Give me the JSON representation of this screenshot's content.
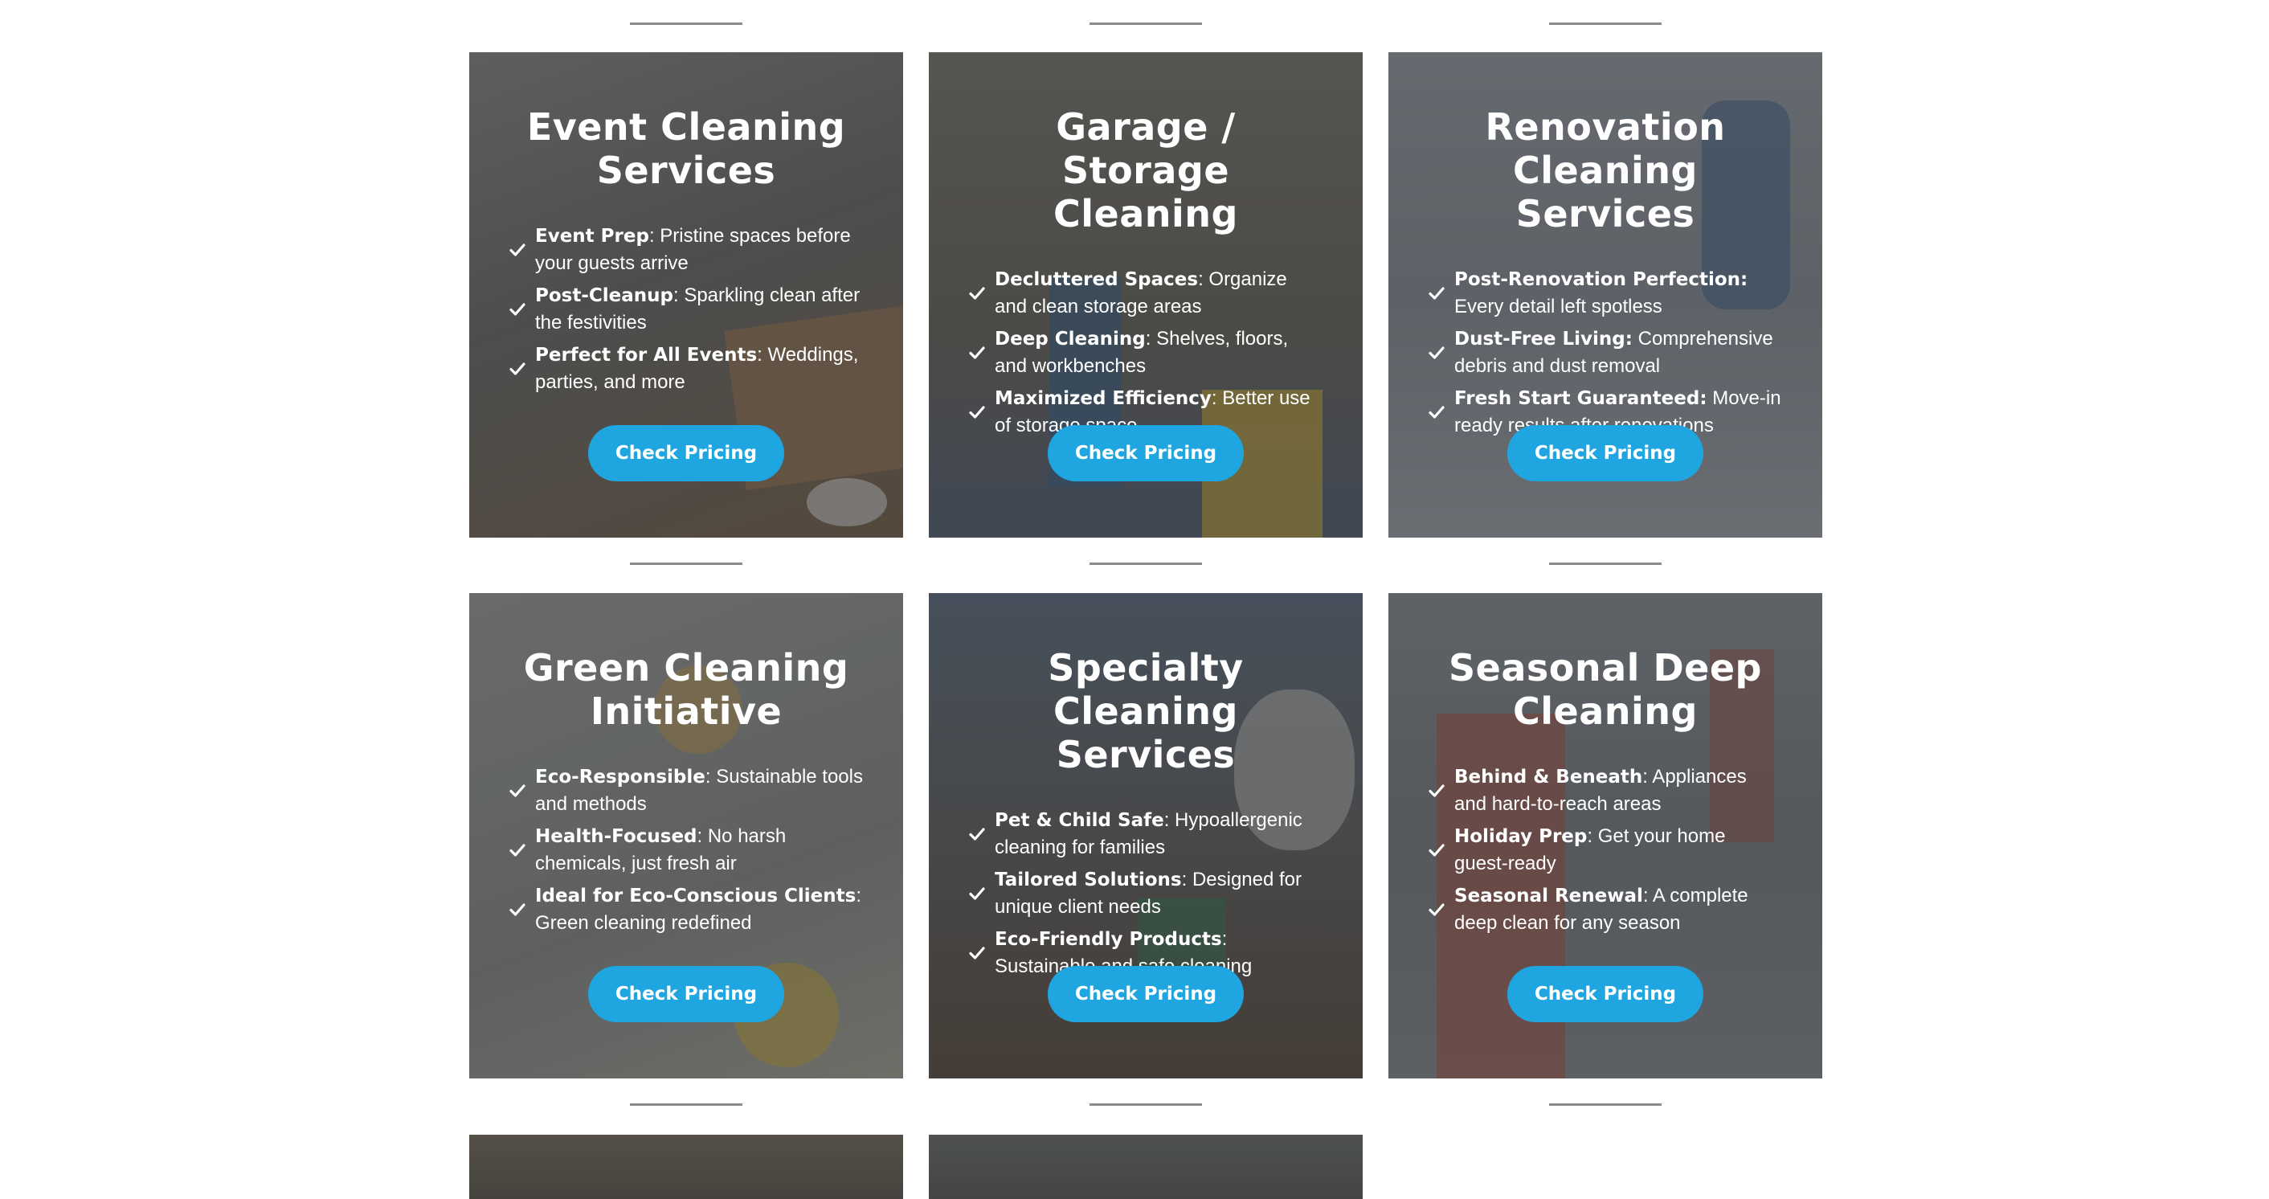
{
  "cards": [
    {
      "title": "Event Cleaning Services",
      "items": [
        {
          "bold": "Event Prep",
          "text": ": Pristine spaces before your guests arrive"
        },
        {
          "bold": "Post-Cleanup",
          "text": ": Sparkling clean after the festivities"
        },
        {
          "bold": "Perfect for All Events",
          "text": ": Weddings, parties, and more"
        }
      ],
      "button": "Check Pricing",
      "bg_color": "#6f6a62"
    },
    {
      "title": "Garage / Storage Cleaning",
      "items": [
        {
          "bold": "Decluttered Spaces",
          "text": ": Organize and clean storage areas"
        },
        {
          "bold": "Deep Cleaning",
          "text": ": Shelves, floors, and workbenches"
        },
        {
          "bold": "Maximized Efficiency",
          "text": ": Better use of storage space"
        }
      ],
      "button": "Check Pricing",
      "bg_color": "#6b6356"
    },
    {
      "title": "Renovation Cleaning Services",
      "items": [
        {
          "bold": "Post-Renovation Perfection:",
          "text": " Every detail left spotless"
        },
        {
          "bold": "Dust-Free Living:",
          "text": " Comprehensive debris and dust removal"
        },
        {
          "bold": "Fresh Start Guaranteed:",
          "text": " Move-in ready results after renovations"
        }
      ],
      "button": "Check Pricing",
      "bg_color": "#8a8d93"
    },
    {
      "title": "Green Cleaning Initiative",
      "items": [
        {
          "bold": "Eco-Responsible",
          "text": ": Sustainable tools and methods"
        },
        {
          "bold": "Health-Focused",
          "text": ": No harsh chemicals, just fresh air"
        },
        {
          "bold": "Ideal for Eco-Conscious Clients",
          "text": ": Green cleaning redefined"
        }
      ],
      "button": "Check Pricing",
      "bg_color": "#8c8b86"
    },
    {
      "title": "Specialty Cleaning Services",
      "items": [
        {
          "bold": "Pet & Child Safe",
          "text": ": Hypoallergenic cleaning for families"
        },
        {
          "bold": "Tailored Solutions",
          "text": ": Designed for unique client needs"
        },
        {
          "bold": "Eco-Friendly Products",
          "text": ": Sustainable and safe cleaning"
        }
      ],
      "button": "Check Pricing",
      "bg_color": "#5e5b58"
    },
    {
      "title": "Seasonal Deep Cleaning",
      "items": [
        {
          "bold": "Behind & Beneath",
          "text": ": Appliances and hard-to-reach areas"
        },
        {
          "bold": "Holiday Prep",
          "text": ": Get your home guest-ready"
        },
        {
          "bold": "Seasonal Renewal",
          "text": ": A complete deep clean for any season"
        }
      ],
      "button": "Check Pricing",
      "bg_color": "#7d7e80"
    }
  ],
  "partial_cards": [
    {
      "bg_color": "#6d6250"
    },
    {
      "bg_color": "#5c5a56"
    }
  ],
  "colors": {
    "accent": "#1fa6e0",
    "divider": "#8a8a8a"
  }
}
